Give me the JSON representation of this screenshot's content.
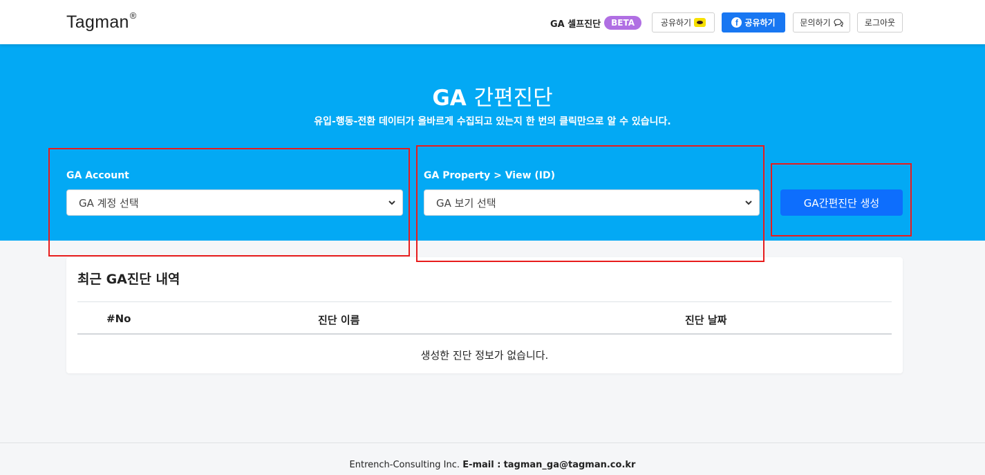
{
  "header": {
    "logo": "Tagman",
    "logo_mark": "®",
    "self_diagnosis_label": "GA 셀프진단",
    "beta_badge": "BETA",
    "kakao_share_label": "공유하기",
    "facebook_share_label": "공유하기",
    "inquiry_label": "문의하기",
    "logout_label": "로그아웃"
  },
  "hero": {
    "title_bold": "GA",
    "title_light": "간편진단",
    "subtitle": "유입-행동-전환 데이터가 올바르게 수집되고 있는지 한 번의 클릭만으로 알 수 있습니다.",
    "account_label": "GA Account",
    "account_select": "GA 계정 선택",
    "property_label": "GA Property > View (ID)",
    "property_select": "GA 보기 선택",
    "generate_button": "GA간편진단 생성"
  },
  "history": {
    "title": "최근 GA진단 내역",
    "columns": [
      "#No",
      "진단 이름",
      "진단 날짜"
    ],
    "empty_message": "생성한 진단 정보가 없습니다."
  },
  "footer": {
    "company": "Entrench-Consulting Inc.",
    "email_label": "E-mail :",
    "email": "tagman_ga@tagman.co.kr"
  },
  "colors": {
    "hero_bg": "#03a9f4",
    "primary_button": "#0d6efd",
    "beta_badge": "#b06fe3",
    "facebook": "#1877f2",
    "kakao": "#f7e000",
    "highlight_box": "#e81c1c"
  },
  "icons": [
    "kakao-icon",
    "facebook-icon",
    "chat-icon",
    "chevron-down-icon"
  ]
}
